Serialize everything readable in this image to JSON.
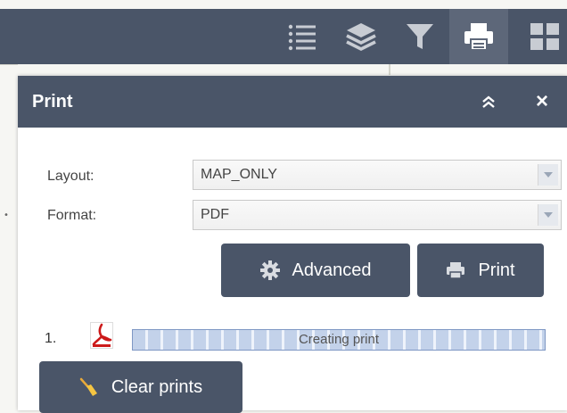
{
  "toolbar": {
    "buttons": [
      {
        "icon": "legend-list-icon"
      },
      {
        "icon": "layers-icon"
      },
      {
        "icon": "filter-icon"
      },
      {
        "icon": "printer-icon",
        "active": true
      },
      {
        "icon": "grid-icon"
      }
    ]
  },
  "panel": {
    "title": "Print",
    "collapse_icon": "double-chevron-up-icon",
    "close_label": "×"
  },
  "form": {
    "layout_label": "Layout:",
    "layout_value": "MAP_ONLY",
    "format_label": "Format:",
    "format_value": "PDF"
  },
  "actions": {
    "advanced_label": "Advanced",
    "print_label": "Print"
  },
  "prints": [
    {
      "index": "1.",
      "type_icon": "pdf-icon",
      "status": "Creating print",
      "progress": 1.0
    }
  ],
  "clear_label": "Clear prints",
  "colors": {
    "header_bg": "#4a5568",
    "active_bg": "#5d6779",
    "progress_border": "#7e97c4",
    "pdf_red": "#cc1a1a"
  }
}
